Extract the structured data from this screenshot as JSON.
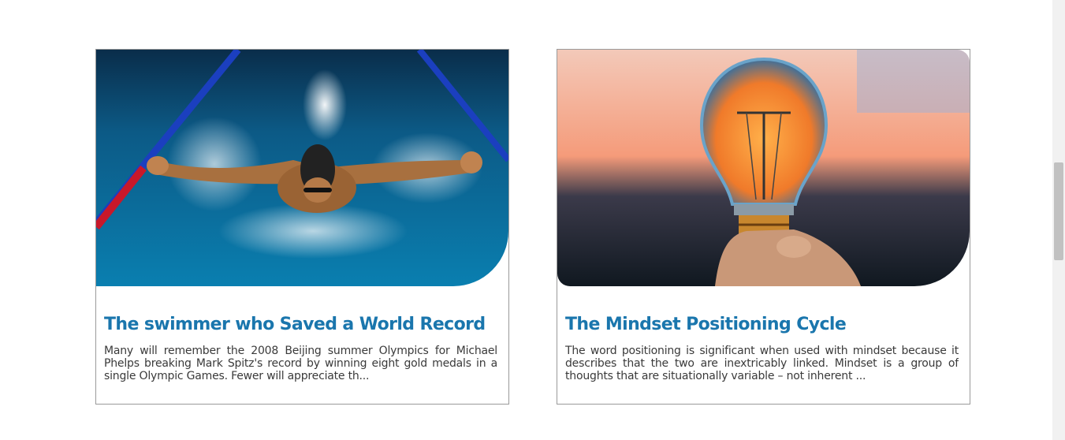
{
  "articles": [
    {
      "title": "The swimmer who Saved a World Record",
      "excerpt": "Many will remember the 2008 Beijing summer Olympics for Michael Phelps breaking Mark Spitz's record by winning eight gold medals in a single Olympic Games. Fewer will appreciate th...",
      "image": "swimmer-photo"
    },
    {
      "title": "The Mindset Positioning Cycle",
      "excerpt": "The word positioning is significant when used with mindset because it describes that the two are inextricably linked. Mindset is a group of thoughts that are situationally variable – not inherent ...",
      "image": "lightbulb-photo"
    }
  ],
  "colors": {
    "title": "#1a76ad",
    "text": "#3a3a3a",
    "border": "#9a9a9a",
    "scrollbar_track": "#f1f1f1",
    "scrollbar_thumb": "#c1c1c1"
  }
}
